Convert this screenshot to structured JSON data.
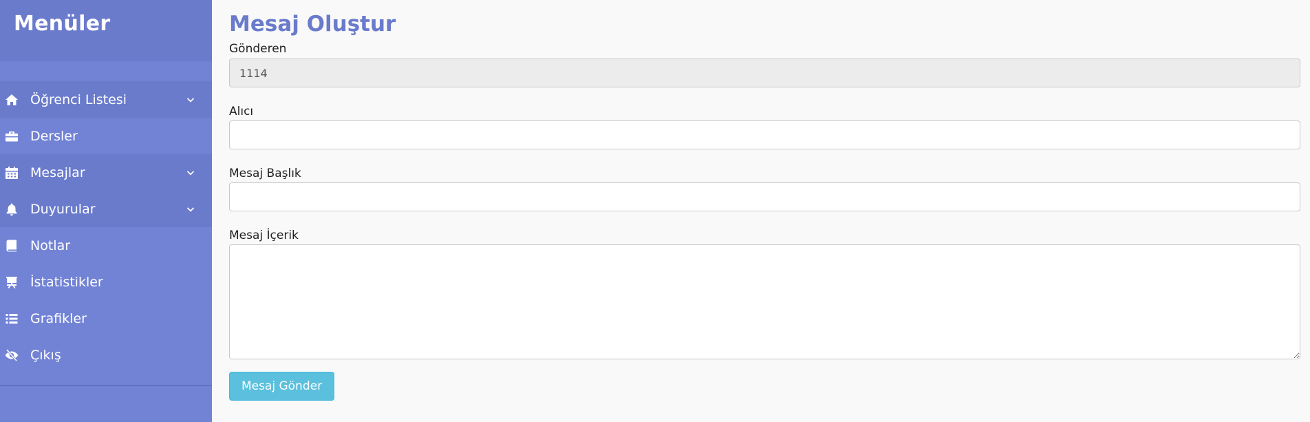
{
  "sidebar": {
    "title": "Menüler",
    "items": [
      {
        "label": "Öğrenci Listesi",
        "icon": "home-icon",
        "has_submenu": true
      },
      {
        "label": "Dersler",
        "icon": "briefcase-icon",
        "has_submenu": false
      },
      {
        "label": "Mesajlar",
        "icon": "calendar-icon",
        "has_submenu": true
      },
      {
        "label": "Duyurular",
        "icon": "bell-icon",
        "has_submenu": true
      },
      {
        "label": "Notlar",
        "icon": "book-icon",
        "has_submenu": false
      },
      {
        "label": "İstatistikler",
        "icon": "easel-icon",
        "has_submenu": false
      },
      {
        "label": "Grafikler",
        "icon": "list-icon",
        "has_submenu": false
      },
      {
        "label": "Çıkış",
        "icon": "eye-slash-icon",
        "has_submenu": false
      }
    ]
  },
  "form": {
    "title": "Mesaj Oluştur",
    "sender": {
      "label": "Gönderen",
      "value": "1114"
    },
    "recipient": {
      "label": "Alıcı",
      "value": ""
    },
    "subject": {
      "label": "Mesaj Başlık",
      "value": ""
    },
    "content": {
      "label": "Mesaj İçerik",
      "value": ""
    },
    "submit_label": "Mesaj Gönder"
  },
  "colors": {
    "sidebar": "#7283d6",
    "sidebar_dark": "#6a7bcc",
    "title": "#6a7bcc",
    "button": "#5bc0de"
  }
}
